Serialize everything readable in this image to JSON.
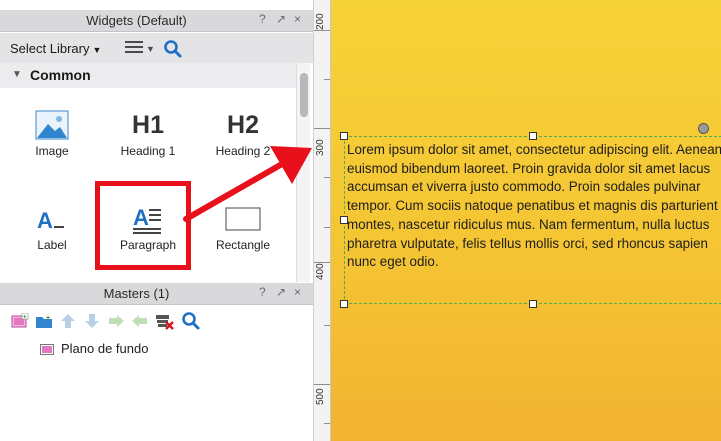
{
  "widgets_panel": {
    "title": "Widgets (Default)",
    "controls": [
      "?",
      "↗",
      "×"
    ],
    "library_label": "Select Library",
    "section": "Common",
    "items": [
      {
        "label": "Image",
        "icon": "image-icon"
      },
      {
        "label": "Heading 1",
        "icon": "heading-1-icon",
        "glyph": "H1"
      },
      {
        "label": "Heading 2",
        "icon": "heading-2-icon",
        "glyph": "H2"
      },
      {
        "label": "Label",
        "icon": "label-icon"
      },
      {
        "label": "Paragraph",
        "icon": "paragraph-icon"
      },
      {
        "label": "Rectangle",
        "icon": "rectangle-icon"
      }
    ]
  },
  "masters_panel": {
    "title": "Masters (1)",
    "controls": [
      "?",
      "↗",
      "×"
    ],
    "toolbar_icons": [
      "add-master-icon",
      "add-folder-icon",
      "move-up-icon",
      "move-down-icon",
      "indent-icon",
      "outdent-icon",
      "delete-icon",
      "search-icon"
    ],
    "items": [
      {
        "label": "Plano de fundo"
      }
    ]
  },
  "ruler": {
    "labels": [
      "200",
      "300",
      "400",
      "500"
    ]
  },
  "canvas": {
    "paragraph_text": "Lorem ipsum dolor sit amet, consectetur adipiscing elit. Aenean euismod bibendum laoreet. Proin gravida dolor sit amet lacus accumsan et viverra justo commodo. Proin sodales pulvinar tempor. Cum sociis natoque penatibus et magnis dis parturient montes, nascetur ridiculus mus. Nam fermentum, nulla luctus pharetra vulputate, felis tellus mollis orci, sed rhoncus sapien nunc eget odio.",
    "background_colors": [
      "#f6d338",
      "#f2b331"
    ],
    "selection_color": "#4caf50",
    "annotation_color": "#e8101a"
  }
}
